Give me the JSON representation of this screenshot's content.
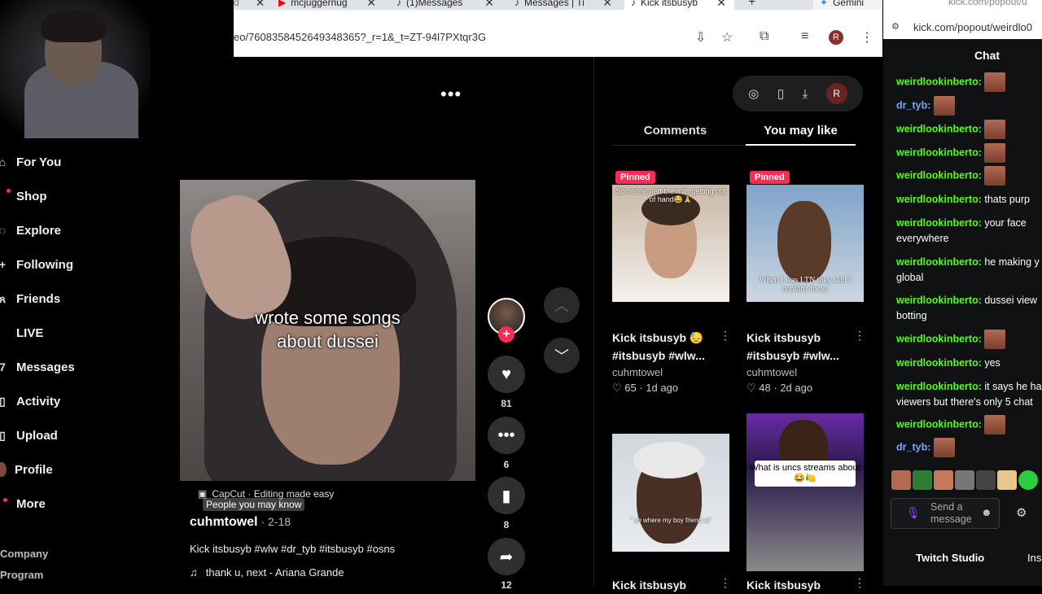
{
  "browser": {
    "tabs": [
      {
        "label": "mcjuggernug"
      },
      {
        "label": "(1)Messages"
      },
      {
        "label": "Messages | Ti"
      },
      {
        "label": "Kick itsbusyb"
      }
    ],
    "new_tab": "+",
    "gemini_label": "Gemini",
    "url": "eo/7608358452649348365?_r=1&_t=ZT-94l7PXtqr3G",
    "profile_initial": "R"
  },
  "nav": {
    "items": [
      {
        "label": "For You"
      },
      {
        "label": "Shop"
      },
      {
        "label": "Explore"
      },
      {
        "label": "Following"
      },
      {
        "label": "Friends"
      },
      {
        "label": "LIVE"
      },
      {
        "label": "Messages"
      },
      {
        "label": "Activity"
      },
      {
        "label": "Upload"
      },
      {
        "label": "Profile"
      },
      {
        "label": "More"
      }
    ],
    "footer": [
      "Company",
      "Program"
    ]
  },
  "video": {
    "caption_line1": "wrote some songs",
    "caption_line2": "about dussei",
    "capcut_label": "CapCut · Editing made easy",
    "people_you_may_know": "People you may know",
    "author": "cuhmtowel",
    "date": " · 2-18",
    "description": "Kick itsbusyb #wlw #dr_tyb #itsbusyb #osns",
    "music": "thank u, next - Ariana Grande",
    "likes": "81",
    "comments": "6",
    "saves": "8",
    "shares": "12"
  },
  "side_panel": {
    "pill_avatar": "R",
    "tab_comments": "Comments",
    "tab_you_may_like": "You may like",
    "cards": [
      {
        "pinned": "Pinned",
        "overlay": "Someone nerf them its getting out of hand😂🙏",
        "title1": "Kick itsbusyb 😓",
        "title2": "#itsbusyb #wlw...",
        "user": "cuhmtowel",
        "likes": "65",
        "age": "1d ago"
      },
      {
        "pinned": "Pinned",
        "overlay": "When I was LTN they said I couldn't focus",
        "title1": "Kick itsbusyb",
        "title2": "#itsbusyb #wlw...",
        "user": "cuhmtowel",
        "likes": "48",
        "age": "2d ago"
      },
      {
        "overlay": "\" yo where my boy friend at\"",
        "title1": "Kick itsbusyb"
      },
      {
        "overlay": "What is uncs streams about 😂🍋",
        "title1": "Kick itsbusyb"
      }
    ]
  },
  "kick": {
    "url": "kick.com/popout/weirdlo0",
    "url_top": "kick.com/popout/u",
    "chat_title": "Chat",
    "messages": [
      {
        "user": "weirdlookinberto",
        "text": "",
        "emote": true,
        "color": "#53fc18"
      },
      {
        "user": "dr_tyb",
        "text": "",
        "emote": true,
        "color": "#7aa8ff"
      },
      {
        "user": "weirdlookinberto",
        "text": "",
        "emote": true,
        "color": "#53fc18"
      },
      {
        "user": "weirdlookinberto",
        "text": "",
        "emote": true,
        "color": "#53fc18"
      },
      {
        "user": "weirdlookinberto",
        "text": "",
        "emote": true,
        "color": "#53fc18"
      },
      {
        "user": "weirdlookinberto",
        "text": "thats purp",
        "emote": false,
        "color": "#53fc18"
      },
      {
        "user": "weirdlookinberto",
        "text": "your face everywhere",
        "emote": false,
        "color": "#53fc18"
      },
      {
        "user": "weirdlookinberto",
        "text": "he making y global",
        "emote": false,
        "color": "#53fc18"
      },
      {
        "user": "weirdlookinberto",
        "text": "dussei view botting",
        "emote": false,
        "color": "#53fc18"
      },
      {
        "user": "weirdlookinberto",
        "text": "",
        "emote": true,
        "color": "#53fc18"
      },
      {
        "user": "weirdlookinberto",
        "text": "yes",
        "emote": false,
        "color": "#53fc18"
      },
      {
        "user": "weirdlookinberto",
        "text": "it says he ha viewers but there's only 5 chat",
        "emote": false,
        "color": "#53fc18"
      },
      {
        "user": "weirdlookinberto",
        "text": "",
        "emote": true,
        "color": "#53fc18"
      },
      {
        "user": "dr_tyb",
        "text": "",
        "emote": true,
        "color": "#7aa8ff"
      }
    ],
    "send_placeholder": "Send a message",
    "twitch_studio": "Twitch Studio",
    "ins": "Ins"
  },
  "colors": {
    "tiktok_red": "#fe2c55",
    "kick_green": "#53fc18",
    "dr_tyb_blue": "#7aa8ff"
  }
}
